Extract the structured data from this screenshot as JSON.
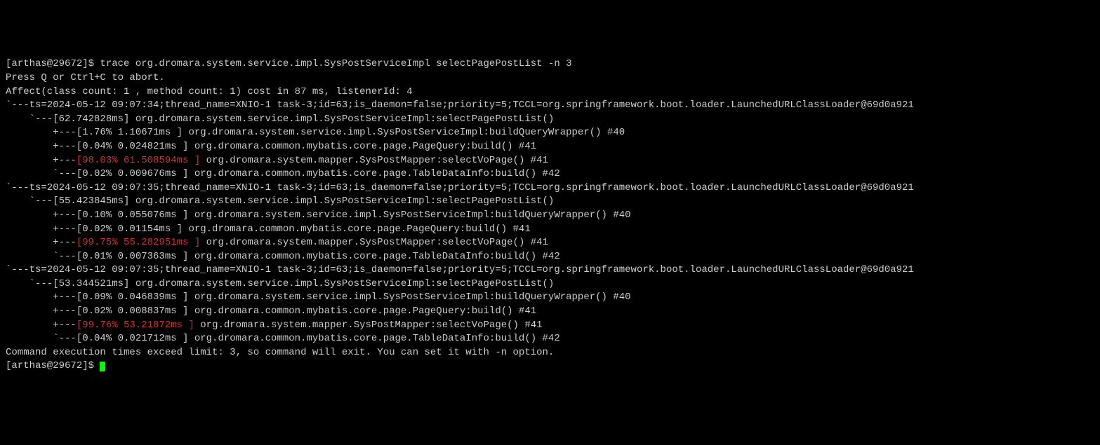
{
  "prompt1": "[arthas@29672]$ ",
  "command": "trace org.dromara.system.service.impl.SysPostServiceImpl selectPagePostList -n 3",
  "abort_hint": "Press Q or Ctrl+C to abort.",
  "affect_line": "Affect(class count: 1 , method count: 1) cost in 87 ms, listenerId: 4",
  "traces": [
    {
      "header": "`---ts=2024-05-12 09:07:34;thread_name=XNIO-1 task-3;id=63;is_daemon=false;priority=5;TCCL=org.springframework.boot.loader.LaunchedURLClassLoader@69d0a921",
      "root": "    `---[62.742828ms] org.dromara.system.service.impl.SysPostServiceImpl:selectPagePostList()",
      "children": [
        {
          "prefix": "        +---",
          "timing": "[1.76% 1.10671ms ]",
          "text": " org.dromara.system.service.impl.SysPostServiceImpl:buildQueryWrapper() #40",
          "highlight": false
        },
        {
          "prefix": "        +---",
          "timing": "[0.04% 0.024821ms ]",
          "text": " org.dromara.common.mybatis.core.page.PageQuery:build() #41",
          "highlight": false
        },
        {
          "prefix": "        +---",
          "timing": "[98.03% 61.508594ms ]",
          "text": " org.dromara.system.mapper.SysPostMapper:selectVoPage() #41",
          "highlight": true
        },
        {
          "prefix": "        `---",
          "timing": "[0.02% 0.009676ms ]",
          "text": " org.dromara.common.mybatis.core.page.TableDataInfo:build() #42",
          "highlight": false
        }
      ]
    },
    {
      "header": "`---ts=2024-05-12 09:07:35;thread_name=XNIO-1 task-3;id=63;is_daemon=false;priority=5;TCCL=org.springframework.boot.loader.LaunchedURLClassLoader@69d0a921",
      "root": "    `---[55.423845ms] org.dromara.system.service.impl.SysPostServiceImpl:selectPagePostList()",
      "children": [
        {
          "prefix": "        +---",
          "timing": "[0.10% 0.055076ms ]",
          "text": " org.dromara.system.service.impl.SysPostServiceImpl:buildQueryWrapper() #40",
          "highlight": false
        },
        {
          "prefix": "        +---",
          "timing": "[0.02% 0.01154ms ]",
          "text": " org.dromara.common.mybatis.core.page.PageQuery:build() #41",
          "highlight": false
        },
        {
          "prefix": "        +---",
          "timing": "[99.75% 55.282951ms ]",
          "text": " org.dromara.system.mapper.SysPostMapper:selectVoPage() #41",
          "highlight": true
        },
        {
          "prefix": "        `---",
          "timing": "[0.01% 0.007363ms ]",
          "text": " org.dromara.common.mybatis.core.page.TableDataInfo:build() #42",
          "highlight": false
        }
      ]
    },
    {
      "header": "`---ts=2024-05-12 09:07:35;thread_name=XNIO-1 task-3;id=63;is_daemon=false;priority=5;TCCL=org.springframework.boot.loader.LaunchedURLClassLoader@69d0a921",
      "root": "    `---[53.344521ms] org.dromara.system.service.impl.SysPostServiceImpl:selectPagePostList()",
      "children": [
        {
          "prefix": "        +---",
          "timing": "[0.09% 0.046839ms ]",
          "text": " org.dromara.system.service.impl.SysPostServiceImpl:buildQueryWrapper() #40",
          "highlight": false
        },
        {
          "prefix": "        +---",
          "timing": "[0.02% 0.008837ms ]",
          "text": " org.dromara.common.mybatis.core.page.PageQuery:build() #41",
          "highlight": false
        },
        {
          "prefix": "        +---",
          "timing": "[99.76% 53.21872ms ]",
          "text": " org.dromara.system.mapper.SysPostMapper:selectVoPage() #41",
          "highlight": true
        },
        {
          "prefix": "        `---",
          "timing": "[0.04% 0.021712ms ]",
          "text": " org.dromara.common.mybatis.core.page.TableDataInfo:build() #42",
          "highlight": false
        }
      ]
    }
  ],
  "exit_msg": "Command execution times exceed limit: 3, so command will exit. You can set it with -n option.",
  "prompt2": "[arthas@29672]$ "
}
